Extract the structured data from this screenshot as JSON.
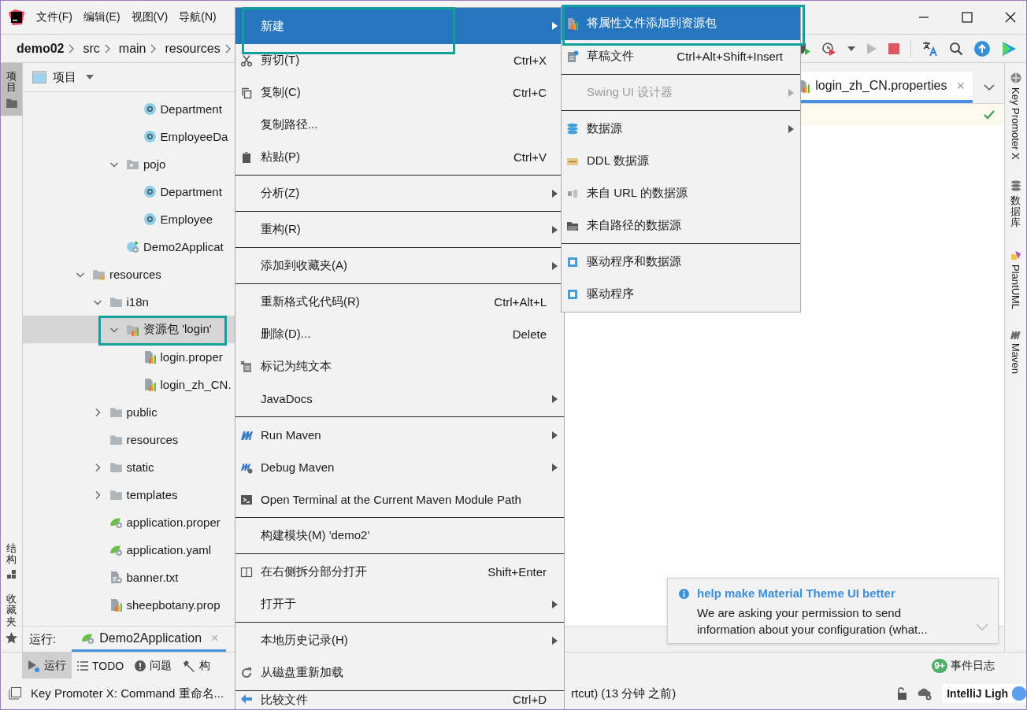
{
  "title_bar": {
    "menus": [
      "文件(F)",
      "编辑(E)",
      "视图(V)",
      "导航(N)"
    ]
  },
  "breadcrumb": [
    "demo02",
    "src",
    "main",
    "resources"
  ],
  "left_strip": {
    "tabs": [
      {
        "label": "项目",
        "selected": true
      },
      {
        "label": "结构",
        "selected": false
      },
      {
        "label": "收藏夹",
        "selected": false
      }
    ]
  },
  "project_panel": {
    "title": "项目",
    "tree": [
      {
        "children": [
          {
            "children": [
              {
                "children": [
                  {
                    "label": "Department",
                    "kind": "class"
                  },
                  {
                    "label": "EmployeeDa",
                    "kind": "class"
                  }
                ]
              },
              {
                "label": "pojo",
                "kind": "package",
                "expanded": true,
                "children": [
                  {
                    "label": "Department",
                    "kind": "class"
                  },
                  {
                    "label": "Employee",
                    "kind": "class"
                  }
                ]
              },
              {
                "label": "Demo2Applicat",
                "kind": "spring-app"
              }
            ]
          }
        ]
      },
      {
        "label": "resources",
        "kind": "resources-root",
        "expanded": true,
        "children": [
          {
            "label": "i18n",
            "kind": "folder",
            "expanded": true,
            "children": [
              {
                "label": "资源包 'login'",
                "kind": "bundle",
                "expanded": true,
                "selected": true,
                "children": [
                  {
                    "label": "login.proper",
                    "kind": "properties",
                    "selected": false
                  },
                  {
                    "label": "login_zh_CN.",
                    "kind": "properties",
                    "selected": false
                  }
                ]
              }
            ],
            "selected": false
          },
          {
            "label": "public",
            "kind": "folder",
            "expanded": false,
            "selected": false
          },
          {
            "label": "resources",
            "kind": "folder",
            "selected": false
          },
          {
            "label": "static",
            "kind": "folder",
            "expanded": false,
            "selected": false
          },
          {
            "label": "templates",
            "kind": "folder",
            "expanded": false,
            "selected": false
          },
          {
            "label": "application.proper",
            "kind": "spring-config",
            "selected": false
          },
          {
            "label": "application.yaml",
            "kind": "spring-config",
            "selected": false
          },
          {
            "label": "banner.txt",
            "kind": "text",
            "selected": false
          },
          {
            "label": "sheepbotany.prop",
            "kind": "properties",
            "selected": false
          }
        ],
        "selected": false
      }
    ]
  },
  "editor": {
    "tab": {
      "label": "login_zh_CN.properties",
      "close": "×",
      "selected": true
    }
  },
  "right_strip": [
    "Key Promoter X",
    "数据库",
    "PlantUML",
    "Maven"
  ],
  "run_bar": {
    "label": "运行:",
    "tab": "Demo2Application",
    "close": "×"
  },
  "tool_tabs": [
    {
      "label": "运行",
      "selected": true
    },
    {
      "label": "TODO",
      "selected": false
    },
    {
      "label": "问题",
      "selected": false
    },
    {
      "label": "构",
      "selected": false
    }
  ],
  "event_log": {
    "badge": "9+",
    "label": "事件日志"
  },
  "notification": {
    "title": "help make Material Theme UI better",
    "lines": [
      "We are asking your permission to send",
      "information about your configuration (what..."
    ]
  },
  "status_bar": {
    "message": "Key Promoter X: Command 重命名...",
    "message_tail": "rtcut) (13 分钟 之前)",
    "theme": "IntelliJ Ligh"
  },
  "context_menu": {
    "items": [
      {
        "kind": "item",
        "label": "新建",
        "submenu": true,
        "selected": true
      },
      {
        "kind": "item",
        "label": "剪切(T)",
        "shortcut": "Ctrl+X",
        "submenu": false,
        "selected": false
      },
      {
        "kind": "item",
        "label": "复制(C)",
        "shortcut": "Ctrl+C",
        "submenu": false,
        "selected": false
      },
      {
        "kind": "item",
        "label": "复制路径...",
        "submenu": false,
        "selected": false
      },
      {
        "kind": "item",
        "label": "粘贴(P)",
        "shortcut": "Ctrl+V",
        "submenu": false,
        "selected": false
      },
      {
        "kind": "separator"
      },
      {
        "kind": "item",
        "label": "分析(Z)",
        "submenu": true,
        "selected": false
      },
      {
        "kind": "separator"
      },
      {
        "kind": "item",
        "label": "重构(R)",
        "submenu": true,
        "selected": false
      },
      {
        "kind": "separator"
      },
      {
        "kind": "item",
        "label": "添加到收藏夹(A)",
        "submenu": true,
        "selected": false
      },
      {
        "kind": "separator"
      },
      {
        "kind": "item",
        "label": "重新格式化代码(R)",
        "shortcut": "Ctrl+Alt+L",
        "submenu": false,
        "selected": false
      },
      {
        "kind": "item",
        "label": "删除(D)...",
        "shortcut": "Delete",
        "submenu": false,
        "selected": false
      },
      {
        "kind": "item",
        "label": "标记为纯文本",
        "submenu": false,
        "selected": false
      },
      {
        "kind": "item",
        "label": "JavaDocs",
        "submenu": true,
        "selected": false
      },
      {
        "kind": "separator"
      },
      {
        "kind": "item",
        "label": "Run Maven",
        "submenu": true,
        "selected": false
      },
      {
        "kind": "item",
        "label": "Debug Maven",
        "submenu": true,
        "selected": false
      },
      {
        "kind": "item",
        "label": "Open Terminal at the Current Maven Module Path",
        "submenu": false,
        "selected": false
      },
      {
        "kind": "separator"
      },
      {
        "kind": "item",
        "label": "构建模块(M) 'demo2'",
        "submenu": false,
        "selected": false
      },
      {
        "kind": "separator"
      },
      {
        "kind": "item",
        "label": "在右侧拆分部分打开",
        "shortcut": "Shift+Enter",
        "submenu": false,
        "selected": false
      },
      {
        "kind": "item",
        "label": "打开于",
        "submenu": true,
        "selected": false
      },
      {
        "kind": "separator"
      },
      {
        "kind": "item",
        "label": "本地历史记录(H)",
        "submenu": true,
        "selected": false
      },
      {
        "kind": "item",
        "label": "从磁盘重新加载",
        "submenu": false,
        "selected": false
      },
      {
        "kind": "separator"
      },
      {
        "kind": "item",
        "label": "比较文件",
        "shortcut": "Ctrl+D",
        "submenu": false,
        "selected": false
      }
    ]
  },
  "submenu": {
    "items": [
      {
        "kind": "item",
        "label": "将属性文件添加到资源包",
        "submenu": false,
        "selected": true,
        "disabled": false
      },
      {
        "kind": "item",
        "label": "草稿文件",
        "shortcut": "Ctrl+Alt+Shift+Insert",
        "submenu": false,
        "selected": false,
        "disabled": false
      },
      {
        "kind": "separator"
      },
      {
        "kind": "item",
        "label": "Swing UI 设计器",
        "submenu": true,
        "selected": false,
        "disabled": true
      },
      {
        "kind": "separator"
      },
      {
        "kind": "item",
        "label": "数据源",
        "submenu": true,
        "selected": false,
        "disabled": false
      },
      {
        "kind": "item",
        "label": "DDL 数据源",
        "submenu": false,
        "selected": false,
        "disabled": false
      },
      {
        "kind": "item",
        "label": "来自 URL 的数据源",
        "submenu": false,
        "selected": false,
        "disabled": false
      },
      {
        "kind": "item",
        "label": "来自路径的数据源",
        "submenu": false,
        "selected": false,
        "disabled": false
      },
      {
        "kind": "separator"
      },
      {
        "kind": "item",
        "label": "驱动程序和数据源",
        "submenu": false,
        "selected": false,
        "disabled": false
      },
      {
        "kind": "item",
        "label": "驱动程序",
        "submenu": false,
        "selected": false,
        "disabled": false
      }
    ]
  }
}
